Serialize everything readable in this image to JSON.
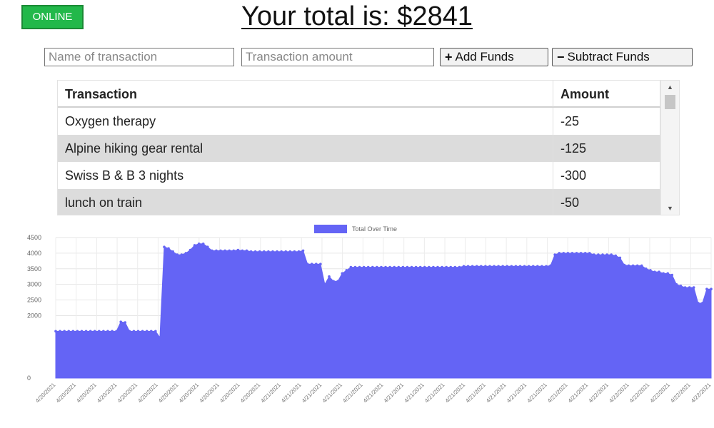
{
  "status": {
    "label": "ONLINE",
    "color": "#22b84a"
  },
  "header": {
    "prefix": "Your total is: $",
    "total": "2841"
  },
  "form": {
    "name_placeholder": "Name of transaction",
    "amount_placeholder": "Transaction amount",
    "add_label": "Add Funds",
    "subtract_label": "Subtract Funds",
    "add_icon": "plus-icon",
    "subtract_icon": "minus-icon"
  },
  "table": {
    "headers": [
      "Transaction",
      "Amount"
    ],
    "rows": [
      {
        "name": "Oxygen therapy",
        "amount": "-25"
      },
      {
        "name": "Alpine hiking gear rental",
        "amount": "-125"
      },
      {
        "name": "Swiss B & B 3 nights",
        "amount": "-300"
      },
      {
        "name": "lunch on train",
        "amount": "-50"
      }
    ]
  },
  "chart_data": {
    "type": "area",
    "legend": "Total Over Time",
    "legend_position": "top-center",
    "color": "#6464f5",
    "grid": true,
    "ylim": [
      0,
      4500
    ],
    "yticks": [
      0,
      2000,
      2500,
      3000,
      3500,
      4000,
      4500
    ],
    "xtick_labels": [
      "4/20/2021",
      "4/20/2021",
      "4/20/2021",
      "4/20/2021",
      "4/20/2021",
      "4/20/2021",
      "4/20/2021",
      "4/20/2021",
      "4/20/2021",
      "4/20/2021",
      "4/20/2021",
      "4/21/2021",
      "4/21/2021",
      "4/21/2021",
      "4/21/2021",
      "4/21/2021",
      "4/21/2021",
      "4/21/2021",
      "4/21/2021",
      "4/21/2021",
      "4/21/2021",
      "4/21/2021",
      "4/21/2021",
      "4/21/2021",
      "4/21/2021",
      "4/21/2021",
      "4/21/2021",
      "4/22/2021",
      "4/22/2021",
      "4/22/2021",
      "4/22/2021",
      "4/22/2021",
      "4/22/2021"
    ],
    "values": [
      1500,
      1500,
      1500,
      1500,
      1500,
      1500,
      1500,
      1500,
      1500,
      1500,
      1500,
      1500,
      1500,
      1500,
      1500,
      1800,
      1780,
      1500,
      1500,
      1500,
      1500,
      1500,
      1500,
      1500,
      1300,
      4200,
      4150,
      4050,
      3950,
      3950,
      4000,
      4100,
      4250,
      4300,
      4300,
      4200,
      4080,
      4080,
      4080,
      4080,
      4080,
      4080,
      4100,
      4080,
      4080,
      4050,
      4050,
      4050,
      4050,
      4050,
      4050,
      4050,
      4050,
      4050,
      4050,
      4050,
      4050,
      4080,
      3650,
      3650,
      3650,
      3650,
      3000,
      3250,
      3100,
      3100,
      3350,
      3450,
      3550,
      3550,
      3550,
      3550,
      3550,
      3550,
      3550,
      3550,
      3550,
      3550,
      3550,
      3550,
      3550,
      3550,
      3550,
      3550,
      3550,
      3550,
      3550,
      3550,
      3550,
      3550,
      3550,
      3550,
      3550,
      3550,
      3580,
      3580,
      3580,
      3580,
      3580,
      3580,
      3580,
      3580,
      3580,
      3580,
      3580,
      3580,
      3580,
      3580,
      3580,
      3580,
      3580,
      3580,
      3580,
      3580,
      3600,
      3950,
      4000,
      4000,
      4000,
      4000,
      4000,
      4000,
      4000,
      4000,
      3950,
      3950,
      3950,
      3950,
      3950,
      3920,
      3850,
      3620,
      3600,
      3600,
      3600,
      3600,
      3500,
      3450,
      3400,
      3400,
      3350,
      3350,
      3300,
      3000,
      2950,
      2900,
      2900,
      2900,
      2400,
      2400,
      2850,
      2850
    ]
  }
}
